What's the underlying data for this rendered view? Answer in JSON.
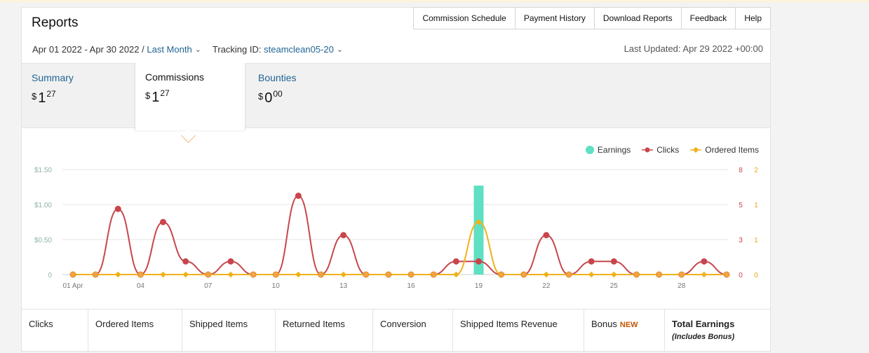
{
  "header": {
    "title": "Reports",
    "nav": [
      "Commission Schedule",
      "Payment History",
      "Download Reports",
      "Feedback",
      "Help"
    ]
  },
  "filters": {
    "date_range": "Apr 01 2022 - Apr 30 2022 /",
    "period": "Last Month",
    "tracking_label": "Tracking ID:",
    "tracking_id": "steamclean05-20",
    "last_updated": "Last Updated: Apr 29 2022 +00:00"
  },
  "tabs": [
    {
      "label": "Summary",
      "currency": "$",
      "whole": "1",
      "cents": "27"
    },
    {
      "label": "Commissions",
      "currency": "$",
      "whole": "1",
      "cents": "27"
    },
    {
      "label": "Bounties",
      "currency": "$",
      "whole": "0",
      "cents": "00"
    }
  ],
  "legend": [
    "Earnings",
    "Clicks",
    "Ordered Items"
  ],
  "colors": {
    "earnings": "#5fe0c3",
    "clicks": "#c8464b",
    "ordered_items": "#f2b11a",
    "link": "#1f6493",
    "new": "#c45500"
  },
  "chart_data": {
    "type": "line",
    "x_tick_labels": [
      "01 Apr",
      "04",
      "07",
      "10",
      "13",
      "16",
      "19",
      "22",
      "25",
      "28"
    ],
    "y_left_ticks": [
      "$1.50",
      "$1.00",
      "$0.50",
      "0"
    ],
    "y_right1_ticks": [
      "8",
      "5",
      "3",
      "0"
    ],
    "y_right2_ticks": [
      "2",
      "1",
      "1",
      "0"
    ],
    "ylim_earnings": [
      0,
      1.5
    ],
    "ylim_clicks": [
      0,
      8
    ],
    "ylim_ordered": [
      0,
      2
    ],
    "x": [
      1,
      2,
      3,
      4,
      5,
      6,
      7,
      8,
      9,
      10,
      11,
      12,
      13,
      14,
      15,
      16,
      17,
      18,
      19,
      20,
      21,
      22,
      23,
      24,
      25,
      26,
      27,
      28,
      29,
      30
    ],
    "series": [
      {
        "name": "Earnings",
        "type": "bar",
        "values": [
          0,
          0,
          0,
          0,
          0,
          0,
          0,
          0,
          0,
          0,
          0,
          0,
          0,
          0,
          0,
          0,
          0,
          0,
          1.27,
          0,
          0,
          0,
          0,
          0,
          0,
          0,
          0,
          0,
          0,
          0
        ]
      },
      {
        "name": "Clicks",
        "type": "line",
        "values": [
          0,
          0,
          5,
          0,
          4,
          1,
          0,
          1,
          0,
          0,
          6,
          0,
          3,
          0,
          0,
          0,
          0,
          1,
          1,
          0,
          0,
          3,
          0,
          1,
          1,
          0,
          0,
          0,
          1,
          0
        ]
      },
      {
        "name": "Ordered Items",
        "type": "line",
        "values": [
          0,
          0,
          0,
          0,
          0,
          0,
          0,
          0,
          0,
          0,
          0,
          0,
          0,
          0,
          0,
          0,
          0,
          0,
          1,
          0,
          0,
          0,
          0,
          0,
          0,
          0,
          0,
          0,
          0,
          0
        ]
      }
    ]
  },
  "stats": {
    "clicks": "Clicks",
    "ordered_items": "Ordered Items",
    "shipped_items": "Shipped Items",
    "returned_items": "Returned Items",
    "conversion": "Conversion",
    "shipped_revenue": "Shipped Items Revenue",
    "bonus": "Bonus",
    "bonus_badge": "NEW",
    "total_earnings": "Total Earnings",
    "total_sub": "(Includes Bonus)"
  }
}
